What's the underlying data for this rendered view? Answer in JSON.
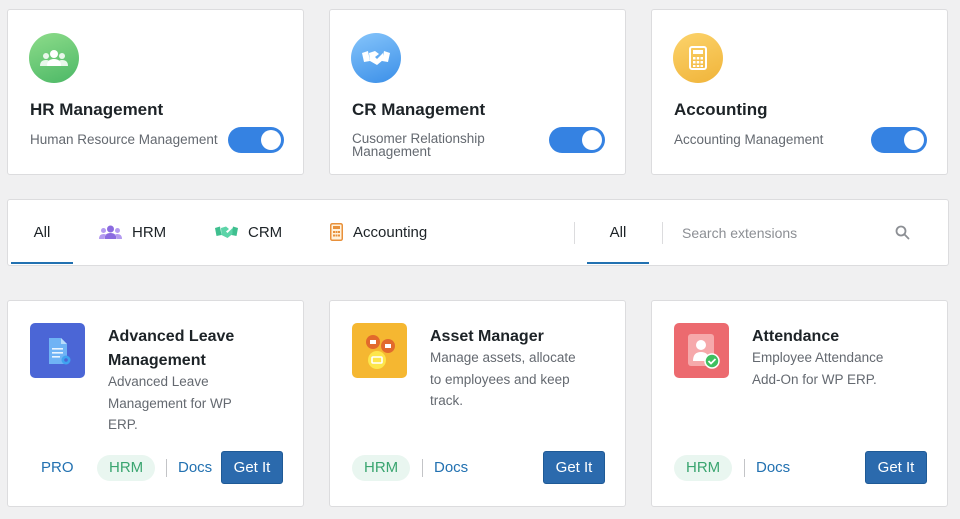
{
  "modules": [
    {
      "title": "HR Management",
      "description": "Human Resource Management",
      "enabled": true
    },
    {
      "title": "CR Management",
      "description": "Cusomer Relationship Management",
      "enabled": true
    },
    {
      "title": "Accounting",
      "description": "Accounting Management",
      "enabled": true
    }
  ],
  "filter": {
    "tabs": [
      "All",
      "HRM",
      "CRM",
      "Accounting"
    ],
    "status_tab": "All",
    "search_placeholder": "Search extensions"
  },
  "extensions": [
    {
      "title": "Advanced Leave Management",
      "description": "Advanced Leave Management for WP ERP.",
      "pro_label": "PRO",
      "category": "HRM",
      "docs_label": "Docs",
      "button_label": "Get It"
    },
    {
      "title": "Asset Manager",
      "description": "Manage assets, allocate to employees and keep track.",
      "category": "HRM",
      "docs_label": "Docs",
      "button_label": "Get It"
    },
    {
      "title": "Attendance",
      "description": "Employee Attendance Add-On for WP ERP.",
      "category": "HRM",
      "docs_label": "Docs",
      "button_label": "Get It"
    }
  ],
  "icons": {
    "hr": "users-icon",
    "cr": "handshake-icon",
    "accounting": "calculator-icon"
  },
  "colors": {
    "hr_gradient": [
      "#8ddc8a",
      "#4cb866"
    ],
    "cr_gradient": [
      "#86c5fb",
      "#3b8fe8"
    ],
    "accounting_gradient": [
      "#fcd36b",
      "#f0b43a"
    ],
    "toggle_on": "#3582e2",
    "primary_button": "#2b6aad",
    "link": "#2271b1"
  }
}
